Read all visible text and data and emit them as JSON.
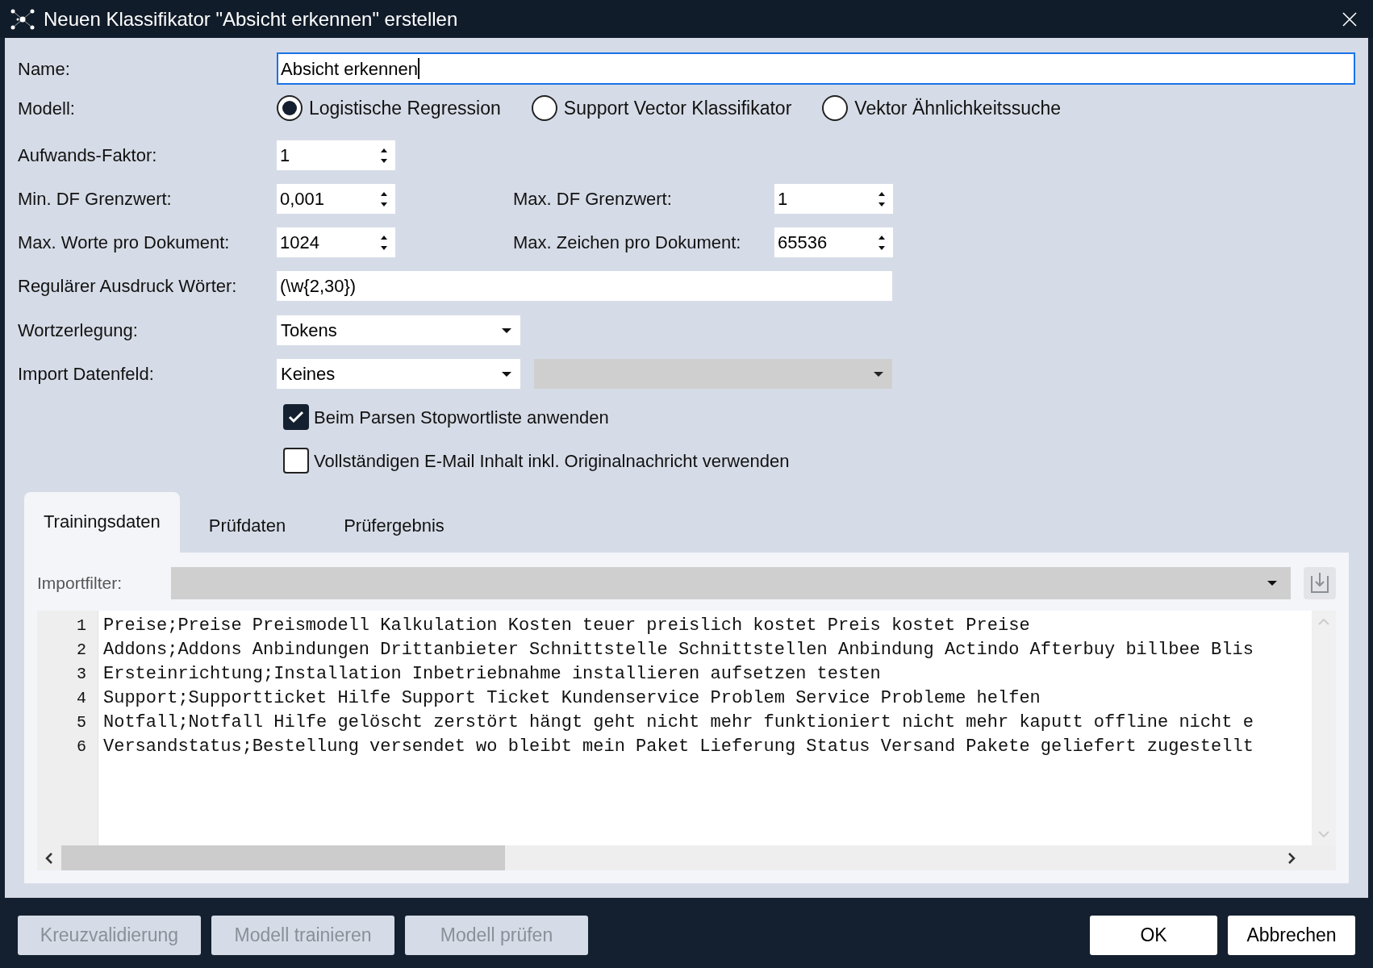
{
  "window": {
    "title": "Neuen Klassifikator \"Absicht erkennen\" erstellen"
  },
  "name": {
    "label": "Name:",
    "value": "Absicht erkennen",
    "focused": true
  },
  "model": {
    "label": "Modell:",
    "options": [
      {
        "label": "Logistische Regression",
        "selected": true
      },
      {
        "label": "Support Vector Klassifikator",
        "selected": false
      },
      {
        "label": "Vektor Ähnlichkeitssuche",
        "selected": false
      }
    ]
  },
  "effort": {
    "label": "Aufwands-Faktor:",
    "value": "1"
  },
  "min_df": {
    "label": "Min. DF Grenzwert:",
    "value": "0,001"
  },
  "max_df": {
    "label": "Max. DF Grenzwert:",
    "value": "1"
  },
  "max_words": {
    "label": "Max. Worte pro Dokument:",
    "value": "1024"
  },
  "max_chars": {
    "label": "Max. Zeichen pro Dokument:",
    "value": "65536"
  },
  "regex": {
    "label": "Regulärer Ausdruck Wörter:",
    "value": "(\\w{2,30})"
  },
  "tokenizer": {
    "label": "Wortzerlegung:",
    "value": "Tokens"
  },
  "import_field": {
    "label": "Import Datenfeld:",
    "value": "Keines",
    "secondary_disabled": true
  },
  "checkboxes": [
    {
      "label": "Beim Parsen Stopwortliste anwenden",
      "checked": true
    },
    {
      "label": "Vollständigen E-Mail Inhalt inkl. Originalnachricht verwenden",
      "checked": false
    }
  ],
  "tabs": [
    {
      "label": "Trainingsdaten",
      "selected": true
    },
    {
      "label": "Prüfdaten",
      "selected": false
    },
    {
      "label": "Prüfergebnis",
      "selected": false
    }
  ],
  "import_filter": {
    "label": "Importfilter:",
    "disabled": true
  },
  "editor": {
    "lines": [
      {
        "number": "1",
        "text": "Preise;Preise Preismodell Kalkulation Kosten teuer preislich kostet Preis kostet Preise"
      },
      {
        "number": "2",
        "text": "Addons;Addons Anbindungen Drittanbieter Schnittstelle Schnittstellen Anbindung Actindo Afterbuy billbee Blis"
      },
      {
        "number": "3",
        "text": "Ersteinrichtung;Installation Inbetriebnahme installieren aufsetzen testen"
      },
      {
        "number": "4",
        "text": "Support;Supportticket Hilfe Support Ticket Kundenservice Problem Service Probleme helfen"
      },
      {
        "number": "5",
        "text": "Notfall;Notfall Hilfe gelöscht zerstört hängt geht nicht mehr funktioniert nicht mehr kaputt offline nicht e"
      },
      {
        "number": "6",
        "text": "Versandstatus;Bestellung versendet wo bleibt mein Paket Lieferung Status Versand Pakete geliefert zugestellt"
      }
    ]
  },
  "actions": [
    {
      "label": "Kreuzvalidierung",
      "disabled": true
    },
    {
      "label": "Modell trainieren",
      "disabled": true
    },
    {
      "label": "Modell prüfen",
      "disabled": true
    }
  ],
  "buttons": [
    {
      "label": "OK"
    },
    {
      "label": "Abbrechen"
    }
  ]
}
